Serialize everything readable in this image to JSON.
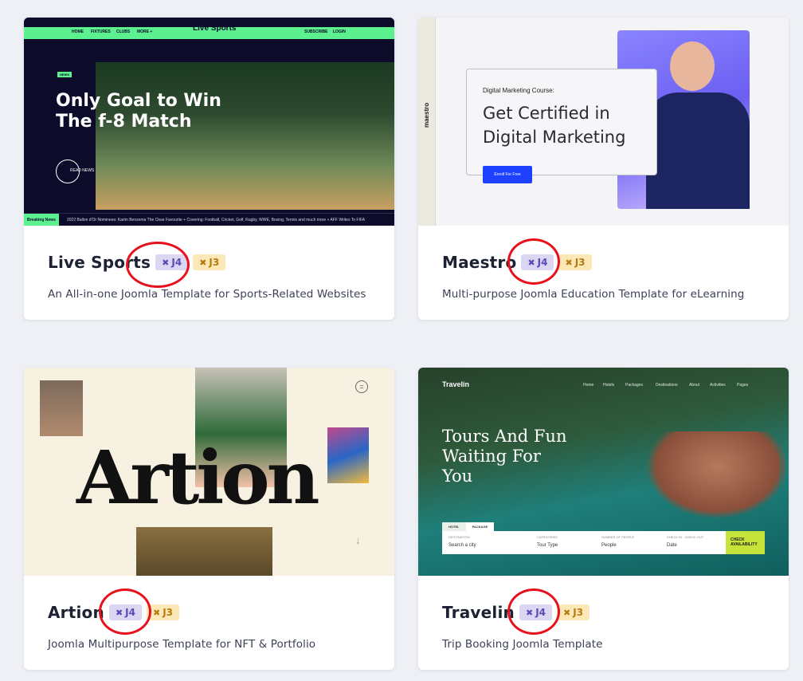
{
  "cards": [
    {
      "title": "Live Sports",
      "description": "An All-in-one Joomla Template for Sports-Related Websites",
      "badges": {
        "j4": "J4",
        "j3": "J3"
      },
      "preview": {
        "nav": [
          "HOME",
          "FIXTURES",
          "CLUBS",
          "MORE +",
          "SUBSCRIBE",
          "LOGIN"
        ],
        "logo": "Live Sports",
        "tag": "NEWS",
        "headline": "Only Goal to Win The f-8 Match",
        "read": "READ NEWS",
        "ticker_tag": "Breaking News",
        "ticker": "2022 Ballon d'Or Nominees: Karim Benzema The Clear Favourite   +   Covering: Football, Cricket, Golf, Rugby, WWE, Boxing, Tennis and much more   +   AFF Writes To FIFA"
      }
    },
    {
      "title": "Maestro",
      "description": "Multi-purpose Joomla Education Template for eLearning",
      "badges": {
        "j4": "J4",
        "j3": "J3"
      },
      "preview": {
        "logo": "maestro",
        "course_label": "Digital Marketing Course:",
        "course_title": "Get Certified in Digital Marketing",
        "enroll": "Enroll For Free"
      }
    },
    {
      "title": "Artion",
      "description": "Joomla Multipurpose Template for NFT & Portfolio",
      "badges": {
        "j4": "J4",
        "j3": "J3"
      },
      "preview": {
        "word": "Artion"
      }
    },
    {
      "title": "Travelin",
      "description": "Trip Booking Joomla Template",
      "badges": {
        "j4": "J4",
        "j3": "J3"
      },
      "preview": {
        "brand": "Travelin",
        "menu": [
          "Home",
          "Hotels",
          "Packages",
          "Destinations",
          "About",
          "Activities",
          "Pages"
        ],
        "hero": "Tours And Fun Waiting For You",
        "tabs": [
          "HOTEL",
          "PACKAGE"
        ],
        "fields": [
          {
            "label": "DESTINATION",
            "value": "Search a city"
          },
          {
            "label": "CATEGORIES",
            "value": "Tour Type"
          },
          {
            "label": "NUMBER OF PEOPLE",
            "value": "People"
          },
          {
            "label": "CHECK IN - CHECK OUT",
            "value": "Date"
          }
        ],
        "check": "CHECK AVAILABILITY"
      }
    }
  ],
  "colors": {
    "j4_bg": "#dcd6f3",
    "j4_text": "#5b4ab6",
    "j3_bg": "#fbe8b6",
    "j3_text": "#b57a10",
    "highlight": "#e8101c"
  },
  "icons": [
    "joomla-icon"
  ]
}
